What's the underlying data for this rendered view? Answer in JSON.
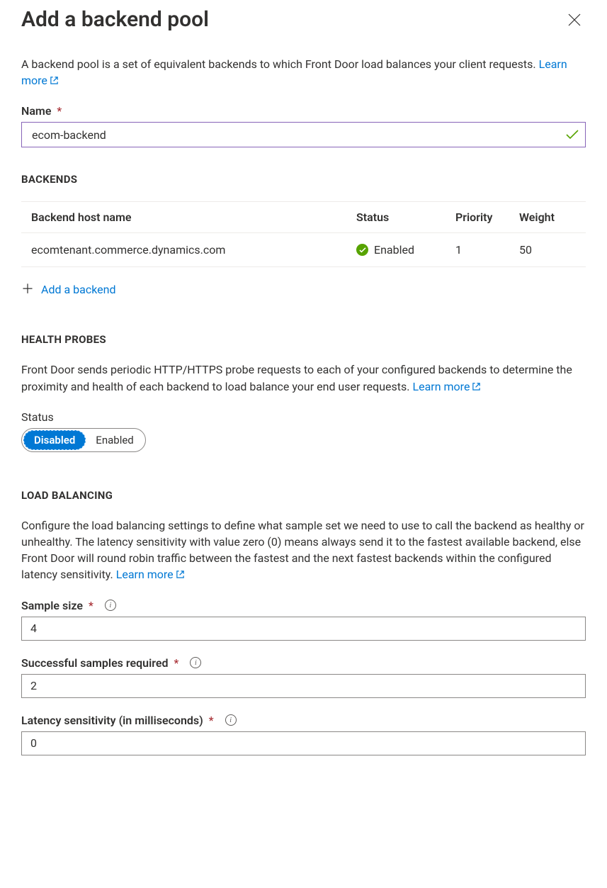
{
  "header": {
    "title": "Add a backend pool"
  },
  "intro": {
    "text_part1": "A backend pool is a set of equivalent backends to which Front Door load balances your client requests. ",
    "learn_more": "Learn more"
  },
  "name_field": {
    "label": "Name",
    "value": "ecom-backend"
  },
  "backends": {
    "title": "BACKENDS",
    "columns": {
      "host": "Backend host name",
      "status": "Status",
      "priority": "Priority",
      "weight": "Weight"
    },
    "rows": [
      {
        "host": "ecomtenant.commerce.dynamics.com",
        "status": "Enabled",
        "priority": "1",
        "weight": "50"
      }
    ],
    "add_label": "Add a backend"
  },
  "health_probes": {
    "title": "HEALTH PROBES",
    "desc_part1": "Front Door sends periodic HTTP/HTTPS probe requests to each of your configured backends to determine the proximity and health of each backend to load balance your end user requests. ",
    "learn_more": "Learn more",
    "status_label": "Status",
    "disabled": "Disabled",
    "enabled": "Enabled"
  },
  "load_balancing": {
    "title": "LOAD BALANCING",
    "desc_part1": "Configure the load balancing settings to define what sample set we need to use to call the backend as healthy or unhealthy. The latency sensitivity with value zero (0) means always send it to the fastest available backend, else Front Door will round robin traffic between the fastest and the next fastest backends within the configured latency sensitivity. ",
    "learn_more": "Learn more",
    "sample_size": {
      "label": "Sample size",
      "value": "4"
    },
    "successful_samples": {
      "label": "Successful samples required",
      "value": "2"
    },
    "latency": {
      "label": "Latency sensitivity (in milliseconds)",
      "value": "0"
    }
  }
}
